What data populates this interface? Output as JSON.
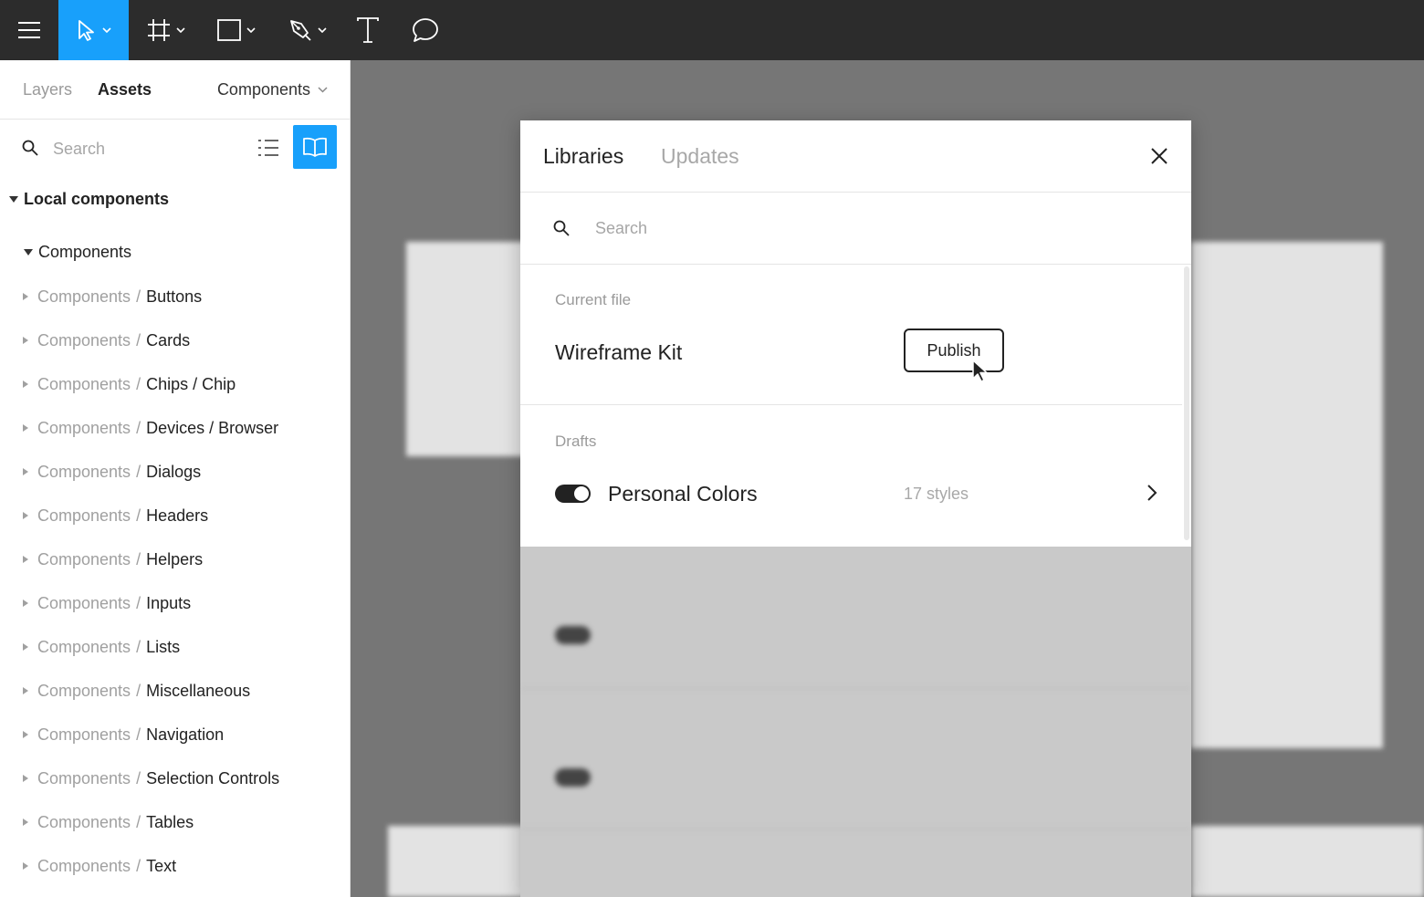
{
  "toolbar": {
    "tools": [
      {
        "name": "main-menu",
        "icon": "hamburger-icon"
      },
      {
        "name": "move-tool",
        "icon": "cursor-arrow-icon",
        "active": true
      },
      {
        "name": "frame-tool",
        "icon": "frame-hash-icon"
      },
      {
        "name": "shape-tool",
        "icon": "rectangle-icon"
      },
      {
        "name": "pen-tool",
        "icon": "pen-icon"
      },
      {
        "name": "text-tool",
        "icon": "text-T-icon"
      },
      {
        "name": "comment-tool",
        "icon": "speech-bubble-icon"
      }
    ],
    "accent_color": "#18a0fb",
    "background_color": "#2c2c2c"
  },
  "sidebar": {
    "tabs": [
      {
        "label": "Layers",
        "active": false
      },
      {
        "label": "Assets",
        "active": true
      }
    ],
    "page_dropdown": "Components",
    "search": {
      "placeholder": "Search",
      "value": ""
    },
    "section_title": "Local components",
    "group_title": "Components",
    "items": [
      {
        "prefix": "Components",
        "name": "Buttons"
      },
      {
        "prefix": "Components",
        "name": "Cards"
      },
      {
        "prefix": "Components",
        "name": "Chips / Chip"
      },
      {
        "prefix": "Components",
        "name": "Devices / Browser"
      },
      {
        "prefix": "Components",
        "name": "Dialogs"
      },
      {
        "prefix": "Components",
        "name": "Headers"
      },
      {
        "prefix": "Components",
        "name": "Helpers"
      },
      {
        "prefix": "Components",
        "name": "Inputs"
      },
      {
        "prefix": "Components",
        "name": "Lists"
      },
      {
        "prefix": "Components",
        "name": "Miscellaneous"
      },
      {
        "prefix": "Components",
        "name": "Navigation"
      },
      {
        "prefix": "Components",
        "name": "Selection Controls"
      },
      {
        "prefix": "Components",
        "name": "Tables"
      },
      {
        "prefix": "Components",
        "name": "Text"
      }
    ]
  },
  "modal": {
    "tabs": [
      {
        "label": "Libraries",
        "active": true
      },
      {
        "label": "Updates",
        "active": false
      }
    ],
    "search": {
      "placeholder": "Search",
      "value": ""
    },
    "current_file": {
      "label": "Current file",
      "title": "Wireframe Kit",
      "publish_label": "Publish"
    },
    "drafts": {
      "label": "Drafts",
      "library_name": "Personal Colors",
      "styles_count": "17 styles",
      "enabled": true
    }
  }
}
